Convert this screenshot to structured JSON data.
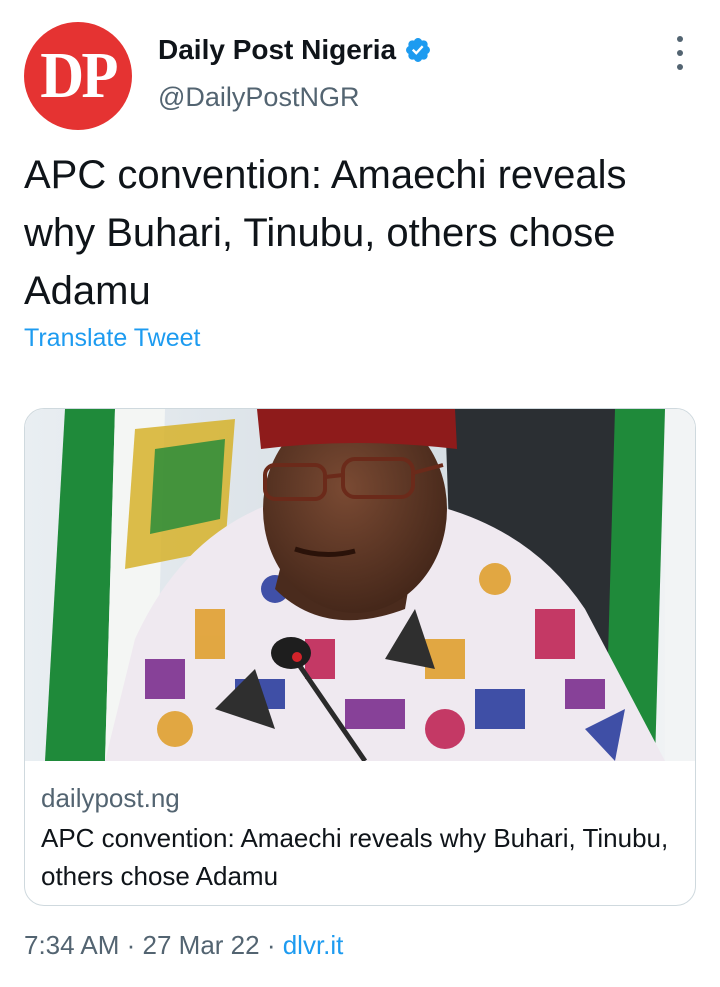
{
  "author": {
    "avatar_text": "DP",
    "name": "Daily Post Nigeria",
    "handle": "@DailyPostNGR",
    "verified_icon": "verified-badge-icon",
    "avatar_color": "#e53332"
  },
  "tweet": {
    "text": "APC convention: Amaechi reveals why Buhari, Tinubu, others chose Adamu",
    "translate_label": "Translate Tweet"
  },
  "card": {
    "domain": "dailypost.ng",
    "title": "APC convention: Amaechi reveals why Buhari, Tinubu, others chose Adamu",
    "image_icon": "article-photo"
  },
  "meta": {
    "time": "7:34 AM",
    "separator": " · ",
    "date": "27 Mar 22",
    "source": "dlvr.it"
  },
  "colors": {
    "link": "#1d9bf0",
    "secondary_text": "#536471",
    "primary_text": "#0f1419",
    "border": "#cfd9de"
  }
}
